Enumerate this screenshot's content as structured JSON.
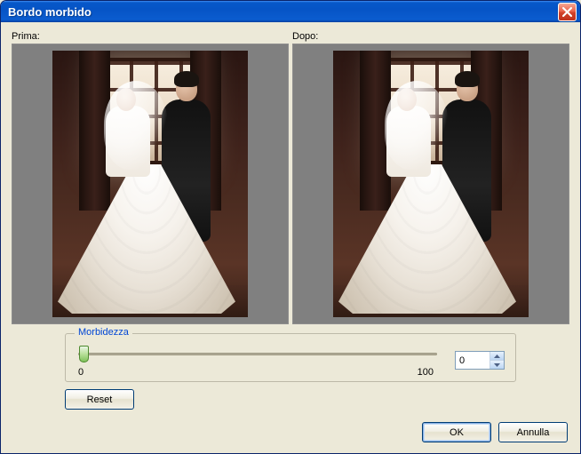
{
  "window": {
    "title": "Bordo morbido"
  },
  "preview": {
    "before_label": "Prima:",
    "after_label": "Dopo:"
  },
  "slider": {
    "legend": "Morbidezza",
    "min_label": "0",
    "max_label": "100",
    "value": "0",
    "min": "0",
    "max": "100"
  },
  "buttons": {
    "reset": "Reset",
    "ok": "OK",
    "cancel": "Annulla"
  }
}
